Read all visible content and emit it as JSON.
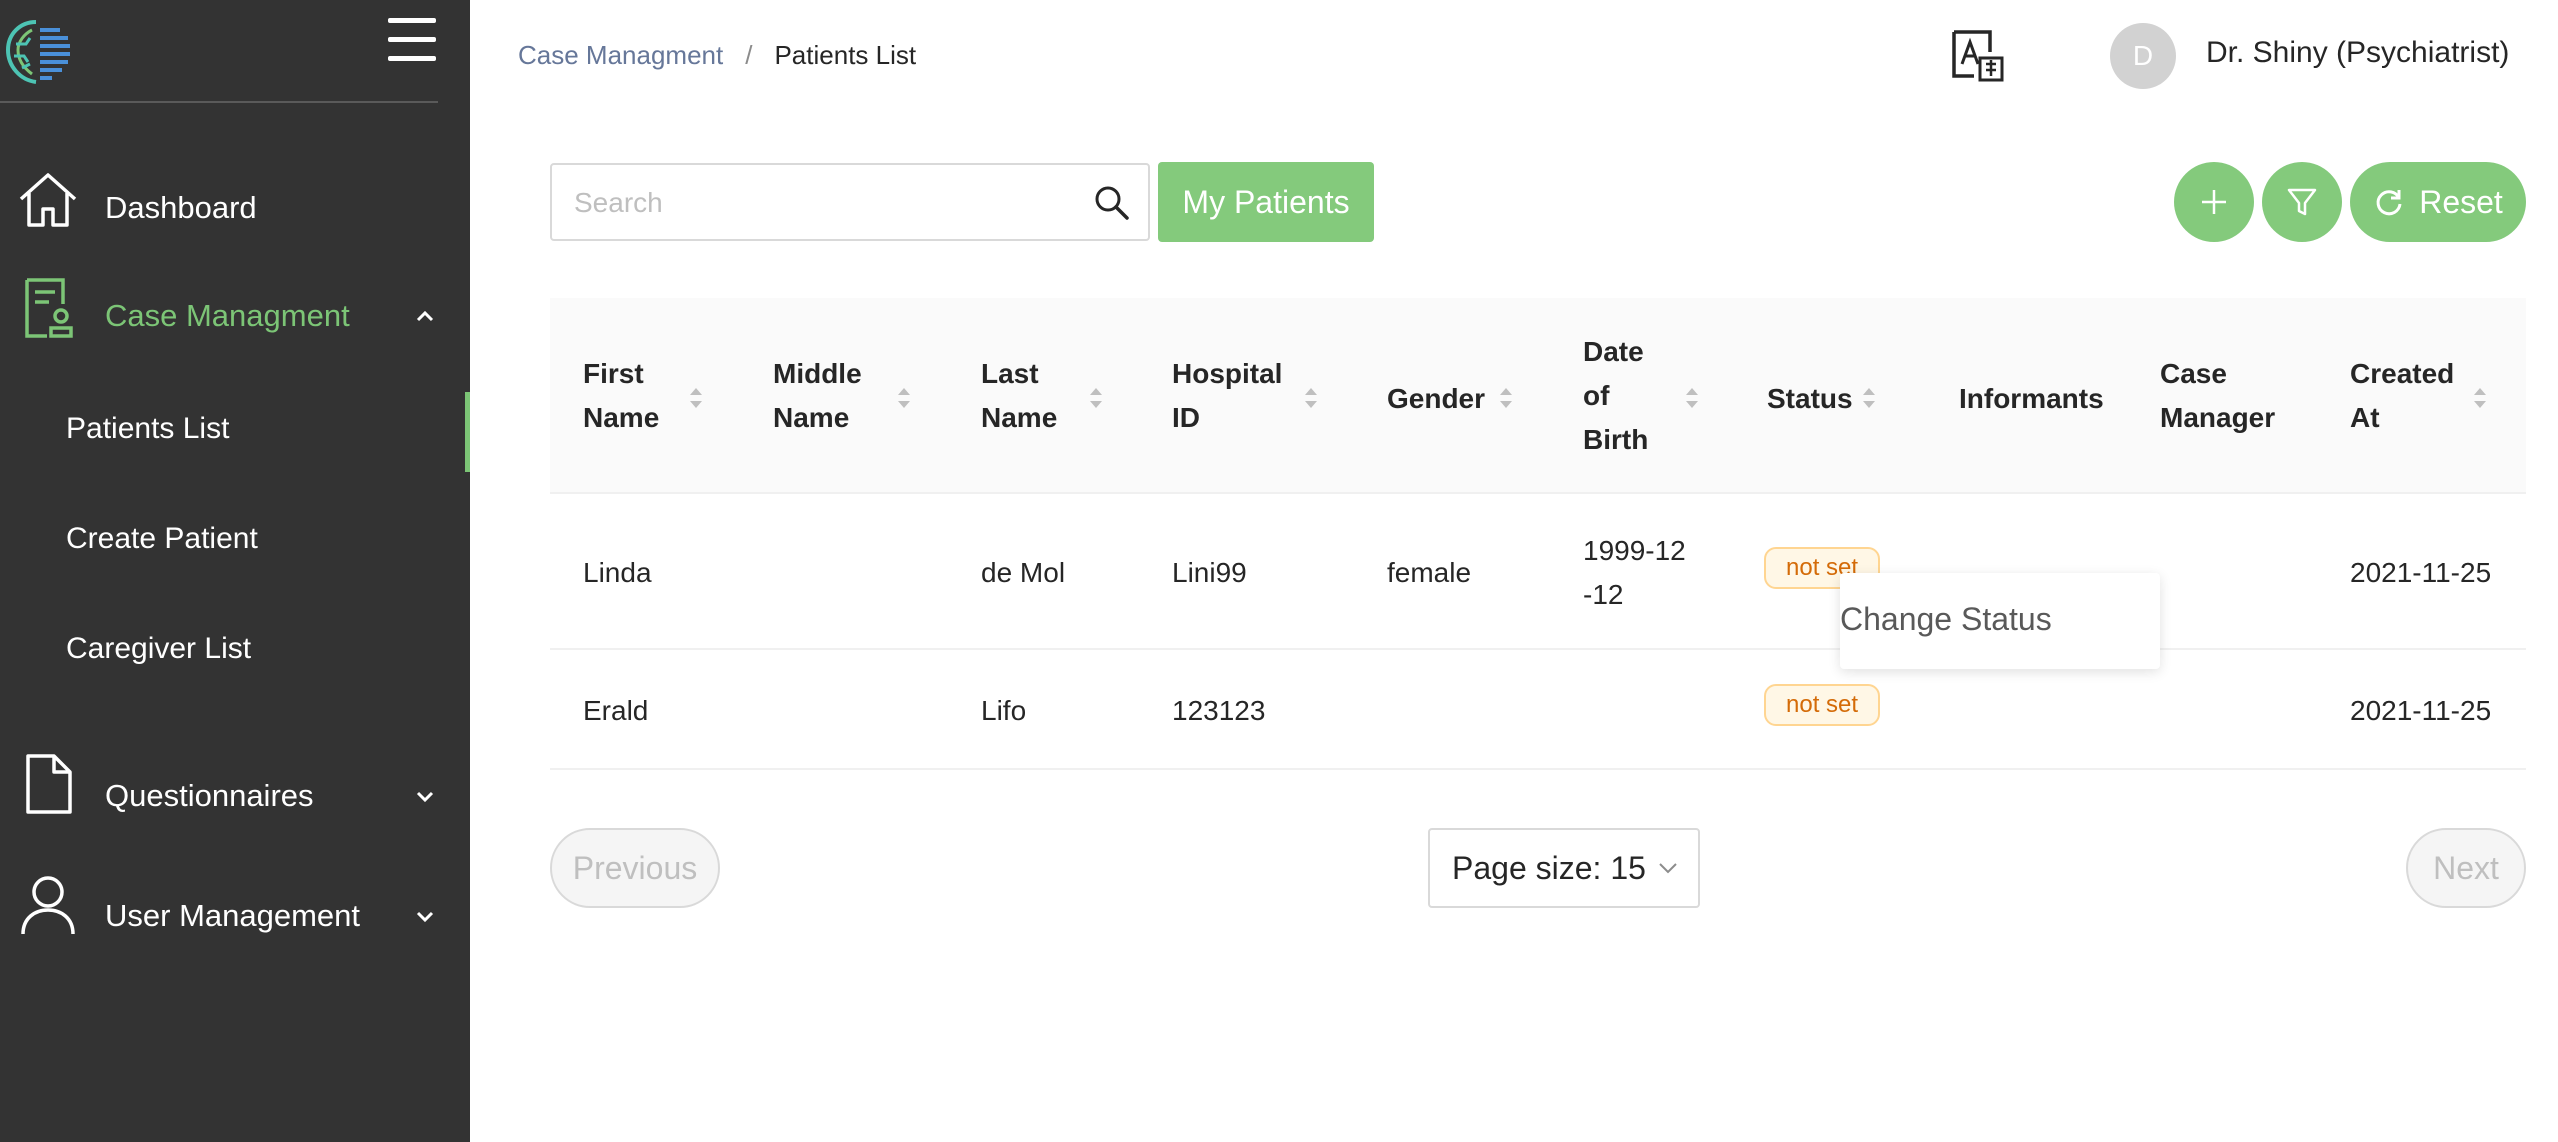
{
  "sidebar": {
    "logo_icon": "brain-logo-icon",
    "menu_icon": "hamburger-menu-icon",
    "items": [
      {
        "label": "Dashboard",
        "icon": "home-icon"
      },
      {
        "label": "Case Managment",
        "icon": "case-file-icon",
        "active": true,
        "expanded": true,
        "children": [
          {
            "label": "Patients List",
            "active": true
          },
          {
            "label": "Create Patient"
          },
          {
            "label": "Caregiver List"
          }
        ]
      },
      {
        "label": "Questionnaires",
        "icon": "document-icon"
      },
      {
        "label": "User Management",
        "icon": "user-icon"
      }
    ]
  },
  "header": {
    "breadcrumb": [
      "Case Managment",
      "Patients List"
    ],
    "breadcrumb_separator": "/",
    "translate_icon": "translate-icon",
    "avatar_initial": "D",
    "user_name": "Dr. Shiny (Psychiatrist)"
  },
  "toolbar": {
    "search_placeholder": "Search",
    "search_value": "",
    "my_patients_label": "My Patients",
    "add_icon": "plus-icon",
    "filter_icon": "filter-icon",
    "reset_label": "Reset",
    "reset_icon": "reload-icon"
  },
  "table": {
    "columns": [
      {
        "label": "First Name",
        "sortable": true
      },
      {
        "label": "Middle Name",
        "sortable": true
      },
      {
        "label": "Last Name",
        "sortable": true
      },
      {
        "label": "Hospital ID",
        "sortable": true
      },
      {
        "label": "Gender",
        "sortable": true
      },
      {
        "label": "Date of Birth",
        "sortable": true
      },
      {
        "label": "Status",
        "sortable": true
      },
      {
        "label": "Informants",
        "sortable": false
      },
      {
        "label": "Case Manager",
        "sortable": false
      },
      {
        "label": "Created At",
        "sortable": true
      }
    ],
    "rows": [
      {
        "first_name": "Linda",
        "middle_name": "",
        "last_name": "de Mol",
        "hospital_id": "Lini99",
        "gender": "female",
        "dob": "1999-12-12",
        "status": "not set",
        "informants": "",
        "case_manager": "",
        "created_at": "2021-11-25"
      },
      {
        "first_name": "Erald",
        "middle_name": "",
        "last_name": "Lifo",
        "hospital_id": "123123",
        "gender": "",
        "dob": "",
        "status": "not set",
        "informants": "",
        "case_manager": "",
        "created_at": "2021-11-25"
      }
    ],
    "popover": {
      "label": "Change Status"
    }
  },
  "pagination": {
    "previous_label": "Previous",
    "next_label": "Next",
    "page_size_label": "Page size: 15"
  },
  "colors": {
    "accent": "#84ca7c",
    "sidebar_bg": "#333333",
    "tag_text": "#d46b08",
    "tag_bg": "#fff7e6",
    "tag_border": "#ffd591"
  }
}
